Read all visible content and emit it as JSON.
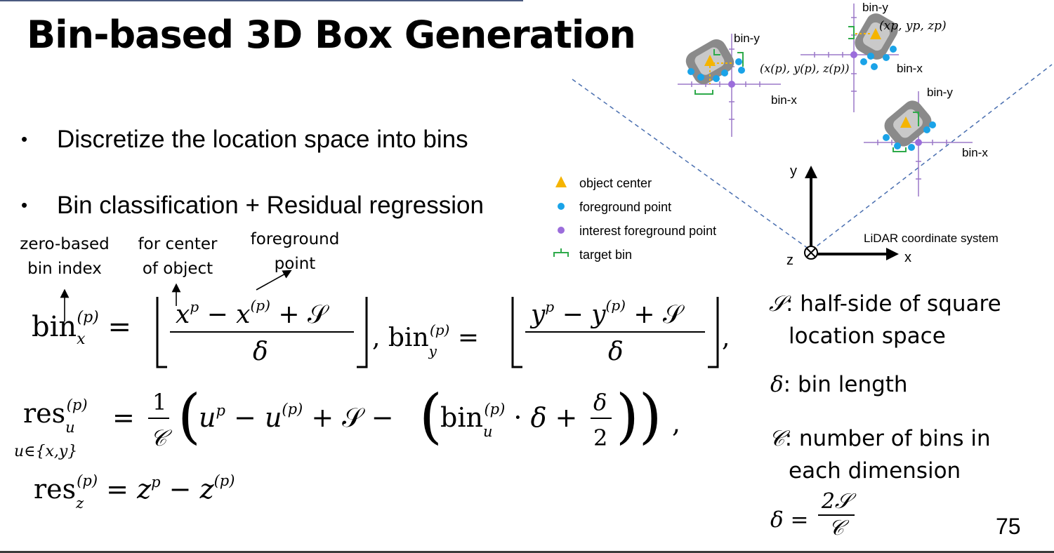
{
  "slide": {
    "title": "Bin-based 3D Box Generation",
    "page_number": "75",
    "bullets": [
      "Discretize the location space into bins",
      "Bin classification + Residual regression"
    ],
    "annotations": {
      "zero_based_line1": "zero-based",
      "zero_based_line2": "bin index",
      "center_line1": "for center",
      "center_line2": "of object",
      "foreground_line1": "foreground",
      "foreground_line2": "point"
    },
    "definitions": {
      "S_symbol": "𝒮",
      "S_text_line1": ": half-side of square",
      "S_text_line2": "location space",
      "delta_symbol": "δ",
      "delta_text": ": bin length",
      "C_symbol": "𝒞",
      "C_text_line1": ": number of bins in",
      "C_text_line2": "each dimension",
      "relation_lhs": "δ =",
      "relation_num": "2𝒮",
      "relation_den": "𝒞"
    },
    "legend": {
      "object_center": "object center",
      "foreground_point": "foreground point",
      "interest_point": "interest foreground point",
      "target_bin": "target bin"
    },
    "diagram": {
      "bin_y": "bin-y",
      "bin_x": "bin-x",
      "axis_y": "y",
      "axis_x": "x",
      "axis_z": "z",
      "coord_label": "LiDAR coordinate system",
      "point_label_1": "(x(p), y(p), z(p))",
      "point_label_2": "(xp, yp, zp)"
    },
    "colors": {
      "bin_axis": "#9b78c8",
      "target_bin": "#2eaa4a",
      "object_center": "#f5b400",
      "foreground_point": "#1aa3e8",
      "interest_point": "#9b6ddb",
      "fov_line": "#4a6fb0"
    }
  }
}
